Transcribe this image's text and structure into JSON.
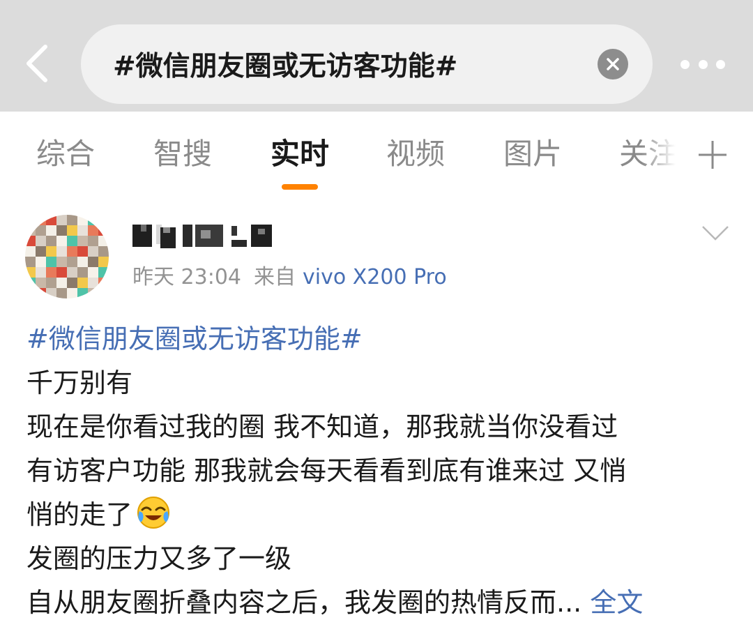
{
  "header": {
    "search_value": "#微信朋友圈或无访客功能#",
    "back_icon": "back-arrow-icon",
    "clear_icon": "clear-circle-icon",
    "more_icon": "more-dots-icon"
  },
  "tabs": {
    "items": [
      {
        "label": "综合"
      },
      {
        "label": "智搜"
      },
      {
        "label": "实时"
      },
      {
        "label": "视频"
      },
      {
        "label": "图片"
      },
      {
        "label": "关注"
      }
    ],
    "active_index": 2,
    "underline_color": "#ff8200",
    "add_icon": "plus-icon"
  },
  "post": {
    "time": "昨天 23:04",
    "source_prefix": "来自",
    "device": "vivo X200 Pro",
    "topic": "#微信朋友圈或无访客功能#",
    "lines": [
      "千万别有",
      "现在是你看过我的圈 我不知道，那我就当你没看过",
      "有访客户功能 那我就会每天看看到底有谁来过 又悄",
      "悄的走了",
      "发圈的压力又多了一级",
      "自从朋友圈折叠内容之后，我发圈的热情反而..."
    ],
    "emoji": "crying-laughing-emoji",
    "full_text_label": "全文",
    "link_color": "#466eb4"
  }
}
